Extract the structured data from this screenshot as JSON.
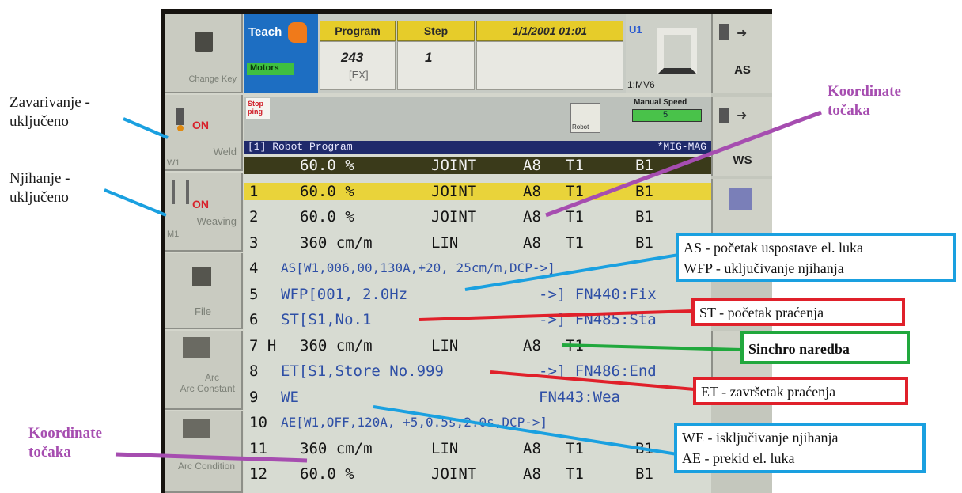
{
  "pendant": {
    "left_keys": {
      "change_key": "Change Key",
      "weld": "Weld",
      "weld_state": "ON",
      "weld_sub": "W1",
      "weaving": "Weaving",
      "weaving_state": "ON",
      "weaving_sub": "M1",
      "file": "File",
      "arc_constant": "Arc Constant",
      "arc_condition": "Arc Condition"
    },
    "header": {
      "mode": "Teach",
      "motors": "Motors",
      "program_label": "Program",
      "program_number": "243",
      "program_type": "[EX]",
      "step_label": "Step",
      "step_value": "1",
      "datetime": "1/1/2001  01:01",
      "unit": "U1",
      "mechanism": "1:MV6",
      "stopping": "Stop ping",
      "manual_speed_label": "Manual Speed",
      "manual_speed_value": "5",
      "robot_icon_label": "Robot"
    },
    "right_keys": {
      "as": "AS",
      "ws": "WS"
    },
    "program": {
      "title": "[1] Robot Program",
      "process": "*MIG-MAG",
      "rows": [
        {
          "n": "",
          "a": "60.0 %",
          "b": "JOINT",
          "c": "A8",
          "d": "T1",
          "e": "B1"
        },
        {
          "n": "1",
          "a": "60.0 %",
          "b": "JOINT",
          "c": "A8",
          "d": "T1",
          "e": "B1"
        },
        {
          "n": "2",
          "a": "60.0 %",
          "b": "JOINT",
          "c": "A8",
          "d": "T1",
          "e": "B1"
        },
        {
          "n": "3",
          "a": "360 cm/m",
          "b": "LIN",
          "c": "A8",
          "d": "T1",
          "e": "B1"
        },
        {
          "n": "4",
          "a": "AS[W1,006,00,130A,+20, 25cm/m,DCP->]",
          "b": "",
          "c": "",
          "d": "",
          "e": ""
        },
        {
          "n": "5",
          "a": "WFP[001, 2.0Hz",
          "b": "->] FN440:Fix",
          "c": "",
          "d": "",
          "e": ""
        },
        {
          "n": "6",
          "a": "ST[S1,No.1",
          "b": "->] FN485:Sta",
          "c": "",
          "d": "",
          "e": ""
        },
        {
          "n": "7 H",
          "a": "360 cm/m",
          "b": "LIN",
          "c": "A8",
          "d": "T1",
          "e": ""
        },
        {
          "n": "8",
          "a": "ET[S1,Store No.999",
          "b": "->] FN486:End",
          "c": "",
          "d": "",
          "e": ""
        },
        {
          "n": "9",
          "a": "WE",
          "b": "FN443:Wea",
          "c": "",
          "d": "",
          "e": ""
        },
        {
          "n": "10",
          "a": "AE[W1,OFF,120A, +5,0.5s,2.0s,DCP->]",
          "b": "",
          "c": "",
          "d": "",
          "e": ""
        },
        {
          "n": "11",
          "a": "360 cm/m",
          "b": "LIN",
          "c": "A8",
          "d": "T1",
          "e": "B1"
        },
        {
          "n": "12",
          "a": "60.0 %",
          "b": "JOINT",
          "c": "A8",
          "d": "T1",
          "e": "B1"
        }
      ]
    }
  },
  "annotations": {
    "weld_on": "Zavarivanje - uključeno",
    "weld_on_l1": "Zavarivanje -",
    "weld_on_l2": "uključeno",
    "weave_on_l1": "Njihanje -",
    "weave_on_l2": "uključeno",
    "coords_top_l1": "Koordinate",
    "coords_top_l2": "točaka",
    "coords_bottom_l1": "Koordinate",
    "coords_bottom_l2": "točaka",
    "as_line": "AS - početak uspostave el. luka",
    "wfp_line": "WFP - uključivanje njihanja",
    "st_line": "ST - početak praćenja",
    "sinchro": "Sinchro naredba",
    "et_line": "ET - završetak praćenja",
    "we_line": "WE - isključivanje njihanja",
    "ae_line": "AE -  prekid el. luka"
  },
  "colors": {
    "annotation_blue": "#1aa0e0",
    "annotation_red": "#e0202a",
    "annotation_green": "#21a83d",
    "annotation_purple": "#a64db0",
    "highlight_yellow": "#e9d33a",
    "selected_row": "#3a3a1a",
    "teach_blue": "#1d6ec2"
  }
}
